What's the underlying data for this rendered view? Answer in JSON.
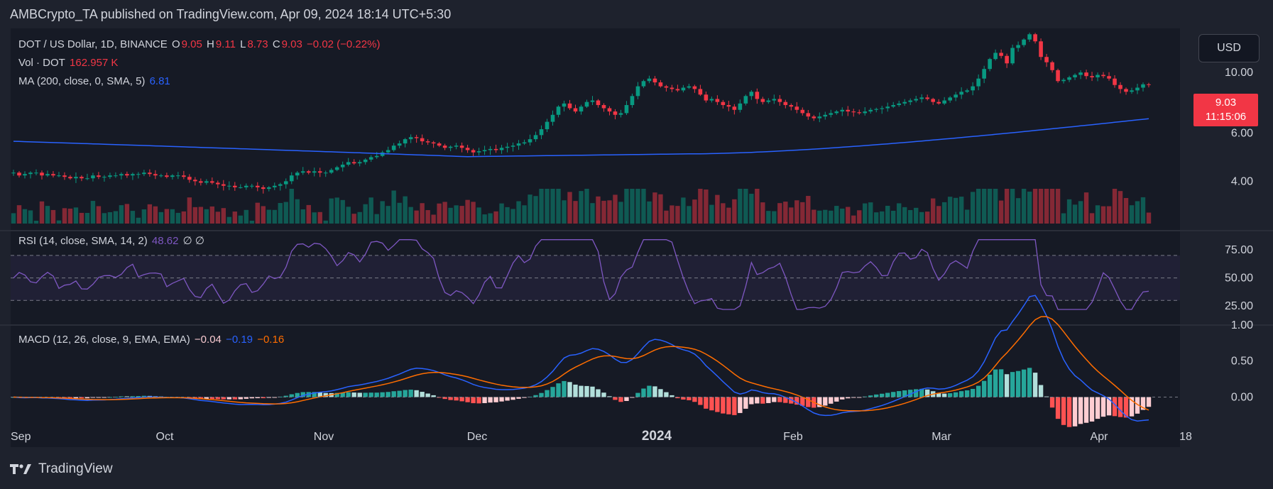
{
  "header": {
    "publish_line": "AMBCrypto_TA published on TradingView.com, Apr 09, 2024 18:14 UTC+5:30"
  },
  "footer": {
    "brand": "TradingView",
    "logo_icon": "tradingview-logo-icon"
  },
  "toolbar": {
    "currency": "USD"
  },
  "price_label": {
    "price": "9.03",
    "countdown": "11:15:06"
  },
  "legend": {
    "symbol": "DOT / US Dollar, 1D, BINANCE",
    "o_label": "O",
    "o_value": "9.05",
    "h_label": "H",
    "h_value": "9.11",
    "l_label": "L",
    "l_value": "8.73",
    "c_label": "C",
    "c_value": "9.03",
    "change": "−0.02 (−0.22%)",
    "vol_label": "Vol · DOT",
    "vol_value": "162.957 K",
    "ma_label": "MA (200, close, 0, SMA, 5)",
    "ma_value": "6.81",
    "rsi_label": "RSI (14, close, SMA, 14, 2)",
    "rsi_value": "48.62",
    "rsi_extra": "∅ ∅",
    "macd_label": "MACD (12, 26, close, 9, EMA, EMA)",
    "macd_hist": "−0.04",
    "macd_line": "−0.19",
    "macd_signal": "−0.16"
  },
  "colors": {
    "background": "#1e222d",
    "up": "#089981",
    "down": "#f23645",
    "ma": "#2962ff",
    "rsi": "#7e57c2",
    "macd": "#2962ff",
    "signal": "#ff6d00"
  },
  "chart_data": {
    "type": "candlestick",
    "x_ticks": [
      "Sep",
      "Oct",
      "Nov",
      "Dec",
      "2024",
      "Feb",
      "Mar",
      "Apr",
      "18"
    ],
    "price_axis": {
      "ticks": [
        "10.00",
        "6.00",
        "4.00"
      ],
      "scale": "log",
      "ylim": [
        2.8,
        14.5
      ]
    },
    "price_series": [
      4.3,
      4.2,
      4.25,
      4.3,
      4.3,
      4.2,
      4.25,
      4.2,
      4.2,
      4.15,
      4.1,
      4.15,
      4.1,
      4.1,
      4.2,
      4.15,
      4.15,
      4.2,
      4.2,
      4.25,
      4.2,
      4.25,
      4.25,
      4.3,
      4.25,
      4.2,
      4.2,
      4.15,
      4.2,
      4.2,
      4.15,
      4.05,
      4.0,
      3.95,
      4.0,
      3.95,
      3.9,
      3.85,
      3.85,
      3.8,
      3.8,
      3.85,
      3.85,
      3.8,
      3.75,
      3.8,
      3.85,
      3.9,
      4.0,
      4.2,
      4.3,
      4.35,
      4.3,
      4.35,
      4.3,
      4.3,
      4.4,
      4.5,
      4.6,
      4.7,
      4.65,
      4.7,
      4.8,
      4.9,
      4.95,
      5.1,
      5.2,
      5.4,
      5.5,
      5.7,
      5.8,
      5.75,
      5.6,
      5.55,
      5.5,
      5.4,
      5.3,
      5.35,
      5.4,
      5.3,
      5.2,
      5.1,
      5.15,
      5.2,
      5.25,
      5.2,
      5.3,
      5.35,
      5.4,
      5.5,
      5.55,
      5.7,
      5.9,
      6.2,
      6.6,
      7.0,
      7.5,
      7.7,
      7.4,
      7.2,
      7.5,
      7.8,
      7.9,
      7.6,
      7.4,
      7.2,
      7.0,
      7.1,
      7.6,
      8.2,
      8.9,
      9.3,
      9.5,
      9.2,
      8.9,
      8.8,
      8.7,
      8.6,
      8.8,
      8.9,
      8.7,
      8.3,
      7.9,
      8.0,
      7.8,
      7.6,
      7.5,
      7.3,
      7.7,
      8.2,
      8.5,
      8.0,
      7.8,
      7.9,
      8.0,
      7.8,
      7.6,
      7.5,
      7.3,
      7.1,
      6.9,
      6.8,
      6.9,
      7.0,
      7.1,
      7.2,
      7.3,
      7.2,
      7.15,
      7.1,
      7.2,
      7.3,
      7.35,
      7.4,
      7.5,
      7.6,
      7.7,
      7.8,
      7.9,
      8.0,
      8.1,
      8.0,
      7.8,
      7.7,
      7.9,
      8.1,
      8.3,
      8.5,
      8.6,
      8.9,
      9.5,
      10.3,
      11.2,
      11.8,
      11.5,
      10.8,
      12.3,
      12.6,
      13.2,
      13.8,
      13.0,
      11.4,
      10.9,
      10.2,
      9.3,
      9.4,
      9.6,
      9.8,
      10.0,
      9.7,
      9.6,
      9.8,
      9.7,
      9.5,
      9.0,
      8.7,
      8.5,
      8.6,
      8.8,
      9.05,
      9.03
    ]
  }
}
